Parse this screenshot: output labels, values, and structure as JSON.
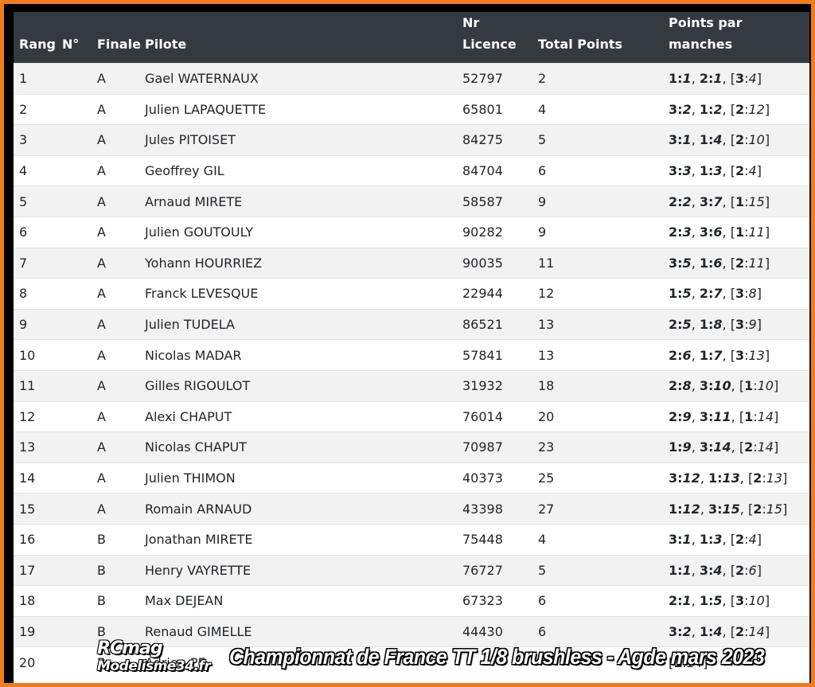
{
  "colors": {
    "frame": "#f07c1b",
    "header_bg": "#343a40",
    "stripe": "#f2f2f2"
  },
  "header": {
    "rang": "Rang",
    "num": "N°",
    "finale": "Finale",
    "pilote": "Pilote",
    "licence_1": "Nr",
    "licence_2": "Licence",
    "total": "Total Points",
    "manches": "Points par manches"
  },
  "rows": [
    {
      "rang": "1",
      "finale": "A",
      "pilote": "Gael WATERNAUX",
      "licence": "52797",
      "total": "2",
      "m": [
        [
          "1",
          "1"
        ],
        [
          "2",
          "1"
        ],
        [
          "3",
          "4"
        ]
      ]
    },
    {
      "rang": "2",
      "finale": "A",
      "pilote": "Julien LAPAQUETTE",
      "licence": "65801",
      "total": "4",
      "m": [
        [
          "3",
          "2"
        ],
        [
          "1",
          "2"
        ],
        [
          "2",
          "12"
        ]
      ]
    },
    {
      "rang": "3",
      "finale": "A",
      "pilote": "Jules PITOISET",
      "licence": "84275",
      "total": "5",
      "m": [
        [
          "3",
          "1"
        ],
        [
          "1",
          "4"
        ],
        [
          "2",
          "10"
        ]
      ]
    },
    {
      "rang": "4",
      "finale": "A",
      "pilote": "Geoffrey GIL",
      "licence": "84704",
      "total": "6",
      "m": [
        [
          "3",
          "3"
        ],
        [
          "1",
          "3"
        ],
        [
          "2",
          "4"
        ]
      ]
    },
    {
      "rang": "5",
      "finale": "A",
      "pilote": "Arnaud MIRETE",
      "licence": "58587",
      "total": "9",
      "m": [
        [
          "2",
          "2"
        ],
        [
          "3",
          "7"
        ],
        [
          "1",
          "15"
        ]
      ]
    },
    {
      "rang": "6",
      "finale": "A",
      "pilote": "Julien GOUTOULY",
      "licence": "90282",
      "total": "9",
      "m": [
        [
          "2",
          "3"
        ],
        [
          "3",
          "6"
        ],
        [
          "1",
          "11"
        ]
      ]
    },
    {
      "rang": "7",
      "finale": "A",
      "pilote": "Yohann HOURRIEZ",
      "licence": "90035",
      "total": "11",
      "m": [
        [
          "3",
          "5"
        ],
        [
          "1",
          "6"
        ],
        [
          "2",
          "11"
        ]
      ]
    },
    {
      "rang": "8",
      "finale": "A",
      "pilote": "Franck LEVESQUE",
      "licence": "22944",
      "total": "12",
      "m": [
        [
          "1",
          "5"
        ],
        [
          "2",
          "7"
        ],
        [
          "3",
          "8"
        ]
      ]
    },
    {
      "rang": "9",
      "finale": "A",
      "pilote": "Julien TUDELA",
      "licence": "86521",
      "total": "13",
      "m": [
        [
          "2",
          "5"
        ],
        [
          "1",
          "8"
        ],
        [
          "3",
          "9"
        ]
      ]
    },
    {
      "rang": "10",
      "finale": "A",
      "pilote": "Nicolas MADAR",
      "licence": "57841",
      "total": "13",
      "m": [
        [
          "2",
          "6"
        ],
        [
          "1",
          "7"
        ],
        [
          "3",
          "13"
        ]
      ]
    },
    {
      "rang": "11",
      "finale": "A",
      "pilote": "Gilles RIGOULOT",
      "licence": "31932",
      "total": "18",
      "m": [
        [
          "2",
          "8"
        ],
        [
          "3",
          "10"
        ],
        [
          "1",
          "10"
        ]
      ]
    },
    {
      "rang": "12",
      "finale": "A",
      "pilote": "Alexi CHAPUT",
      "licence": "76014",
      "total": "20",
      "m": [
        [
          "2",
          "9"
        ],
        [
          "3",
          "11"
        ],
        [
          "1",
          "14"
        ]
      ]
    },
    {
      "rang": "13",
      "finale": "A",
      "pilote": "Nicolas CHAPUT",
      "licence": "70987",
      "total": "23",
      "m": [
        [
          "1",
          "9"
        ],
        [
          "3",
          "14"
        ],
        [
          "2",
          "14"
        ]
      ]
    },
    {
      "rang": "14",
      "finale": "A",
      "pilote": "Julien THIMON",
      "licence": "40373",
      "total": "25",
      "m": [
        [
          "3",
          "12"
        ],
        [
          "1",
          "13"
        ],
        [
          "2",
          "13"
        ]
      ]
    },
    {
      "rang": "15",
      "finale": "A",
      "pilote": "Romain ARNAUD",
      "licence": "43398",
      "total": "27",
      "m": [
        [
          "1",
          "12"
        ],
        [
          "3",
          "15"
        ],
        [
          "2",
          "15"
        ]
      ]
    },
    {
      "rang": "16",
      "finale": "B",
      "pilote": "Jonathan MIRETE",
      "licence": "75448",
      "total": "4",
      "m": [
        [
          "3",
          "1"
        ],
        [
          "1",
          "3"
        ],
        [
          "2",
          "4"
        ]
      ]
    },
    {
      "rang": "17",
      "finale": "B",
      "pilote": "Henry VAYRETTE",
      "licence": "76727",
      "total": "5",
      "m": [
        [
          "1",
          "1"
        ],
        [
          "3",
          "4"
        ],
        [
          "2",
          "6"
        ]
      ]
    },
    {
      "rang": "18",
      "finale": "B",
      "pilote": "Max DEJEAN",
      "licence": "67323",
      "total": "6",
      "m": [
        [
          "2",
          "1"
        ],
        [
          "1",
          "5"
        ],
        [
          "3",
          "10"
        ]
      ]
    },
    {
      "rang": "19",
      "finale": "B",
      "pilote": "Renaud GIMELLE",
      "licence": "44430",
      "total": "6",
      "m": [
        [
          "3",
          "2"
        ],
        [
          "1",
          "4"
        ],
        [
          "2",
          "14"
        ]
      ]
    },
    {
      "rang": "20",
      "finale": "B",
      "pilote": "Adrien PE",
      "licence": "",
      "total": "",
      "m": [
        [
          "",
          "",
          ""
        ],
        [
          "",
          "",
          ""
        ],
        [
          "1",
          "14"
        ]
      ]
    }
  ],
  "watermark": {
    "logo_line1": "RCmag",
    "logo_line2": "Modelisme34.fr",
    "title": "Championnat de France TT 1/8 brushless - Agde mars 2023"
  }
}
